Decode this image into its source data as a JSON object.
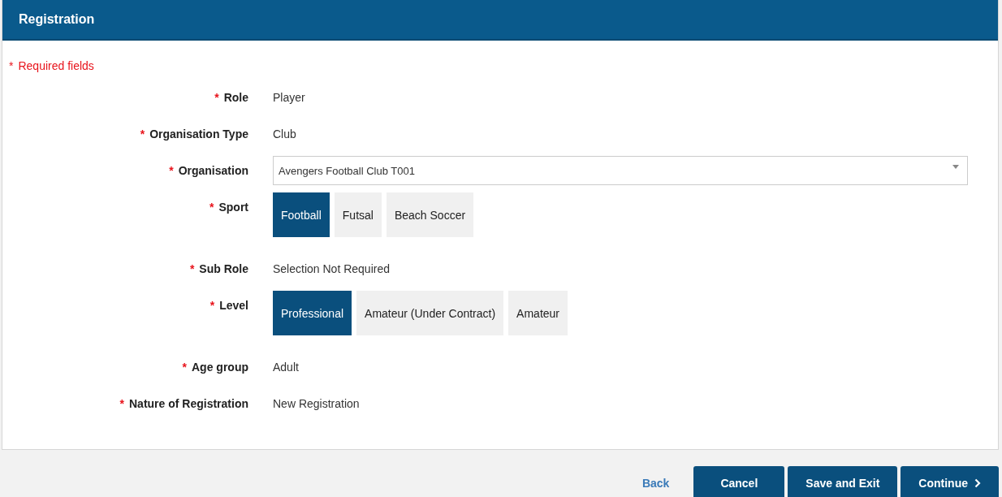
{
  "header": {
    "title": "Registration"
  },
  "required_note": {
    "mark": "*",
    "text": "Required fields"
  },
  "fields": [
    {
      "kind": "text",
      "mark": "*",
      "label": "Role",
      "value": "Player"
    },
    {
      "kind": "text",
      "mark": "*",
      "label": "Organisation Type",
      "value": "Club"
    },
    {
      "kind": "select",
      "mark": "*",
      "label": "Organisation",
      "value": "Avengers Football Club T001"
    },
    {
      "kind": "options",
      "mark": "*",
      "label": "Sport",
      "options": [
        {
          "label": "Football",
          "selected": true
        },
        {
          "label": "Futsal",
          "selected": false
        },
        {
          "label": "Beach Soccer",
          "selected": false
        }
      ]
    },
    {
      "kind": "text",
      "mark": "*",
      "label": "Sub Role",
      "value": "Selection Not Required"
    },
    {
      "kind": "options",
      "mark": "*",
      "label": "Level",
      "options": [
        {
          "label": "Professional",
          "selected": true
        },
        {
          "label": "Amateur (Under Contract)",
          "selected": false
        },
        {
          "label": "Amateur",
          "selected": false
        }
      ]
    },
    {
      "kind": "text",
      "mark": "*",
      "label": "Age group",
      "value": "Adult"
    },
    {
      "kind": "text",
      "mark": "*",
      "label": "Nature of Registration",
      "value": "New Registration"
    }
  ],
  "footer": {
    "back": "Back",
    "buttons": [
      {
        "kind": "plain",
        "label": "Cancel"
      },
      {
        "kind": "plain",
        "label": "Save and Exit"
      },
      {
        "kind": "next",
        "label": "Continue"
      }
    ]
  }
}
